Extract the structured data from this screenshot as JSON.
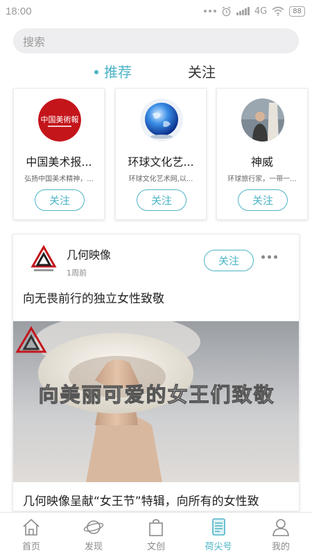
{
  "status_bar": {
    "time": "18:00",
    "network": "4G",
    "network_sub": "ᵢₗ",
    "battery": "88"
  },
  "search": {
    "placeholder": "搜索"
  },
  "tabs": [
    {
      "label": "推荐",
      "active": true
    },
    {
      "label": "关注",
      "active": false
    }
  ],
  "recommend_cards": [
    {
      "name": "中国美术报...",
      "desc": "弘扬中国美术精神，...",
      "follow_label": "关注",
      "logo_text": "中国美術報"
    },
    {
      "name": "环球文化艺...",
      "desc": "环球文化艺术网,以...",
      "follow_label": "关注"
    },
    {
      "name": "神威",
      "desc": "环球旅行家，一带一...",
      "follow_label": "关注"
    }
  ],
  "post": {
    "author": "几何映像",
    "time": "1周前",
    "follow_label": "关注",
    "title": "向无畏前行的独立女性致敬",
    "image_overlay_text": "向美丽可爱的女王们致敬",
    "caption": "几何映像呈献“女王节”特辑，向所有的女性致"
  },
  "bottom_nav": [
    {
      "label": "首页",
      "icon": "home-icon",
      "active": false
    },
    {
      "label": "发现",
      "icon": "planet-icon",
      "active": false
    },
    {
      "label": "文创",
      "icon": "bag-icon",
      "active": false
    },
    {
      "label": "荷尖号",
      "icon": "document-icon",
      "active": true
    },
    {
      "label": "我的",
      "icon": "user-icon",
      "active": false
    }
  ],
  "colors": {
    "accent": "#4bb4c6",
    "text": "#222222",
    "muted": "#8a8a8a"
  }
}
